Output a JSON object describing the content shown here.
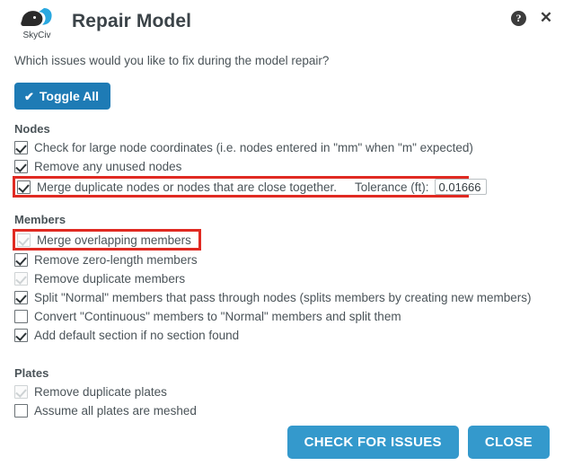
{
  "header": {
    "logo_text": "SkyCiv",
    "title": "Repair Model",
    "help_glyph": "?",
    "close_glyph": "✕"
  },
  "body": {
    "intro": "Which issues would you like to fix during the model repair?",
    "toggle_all": {
      "label": "Toggle All",
      "check_glyph": "✔"
    },
    "sections": [
      {
        "title": "Nodes",
        "options": [
          {
            "label": "Check for large node coordinates (i.e. nodes entered in \"mm\" when \"m\" expected)",
            "checked": true,
            "disabled": false,
            "highlighted": false
          },
          {
            "label": "Remove any unused nodes",
            "checked": true,
            "disabled": false,
            "highlighted": false
          },
          {
            "label": "Merge duplicate nodes or nodes that are close together.",
            "checked": true,
            "disabled": false,
            "highlighted": true,
            "tolerance_label": "Tolerance (ft):",
            "tolerance_value": "0.01666"
          }
        ]
      },
      {
        "title": "Members",
        "options": [
          {
            "label": "Merge overlapping members",
            "checked": true,
            "disabled": true,
            "highlighted": true
          },
          {
            "label": "Remove zero-length members",
            "checked": true,
            "disabled": false,
            "highlighted": false
          },
          {
            "label": "Remove duplicate members",
            "checked": true,
            "disabled": true,
            "highlighted": false
          },
          {
            "label": "Split \"Normal\" members that pass through nodes (splits members by creating new members)",
            "checked": true,
            "disabled": false,
            "highlighted": false
          },
          {
            "label": "Convert \"Continuous\" members to \"Normal\" members and split them",
            "checked": false,
            "disabled": false,
            "highlighted": false
          },
          {
            "label": "Add default section if no section found",
            "checked": true,
            "disabled": false,
            "highlighted": false
          }
        ]
      },
      {
        "title": "Plates",
        "options": [
          {
            "label": "Remove duplicate plates",
            "checked": true,
            "disabled": true,
            "highlighted": false
          },
          {
            "label": "Assume all plates are meshed",
            "checked": false,
            "disabled": false,
            "highlighted": false
          }
        ]
      }
    ]
  },
  "footer": {
    "check_for_issues_label": "CHECK FOR ISSUES",
    "close_label": "CLOSE"
  },
  "colors": {
    "primary_blue": "#1e7bb5",
    "footer_blue": "#3499cc",
    "highlight_red": "#e02a22",
    "text": "#4a5358"
  }
}
